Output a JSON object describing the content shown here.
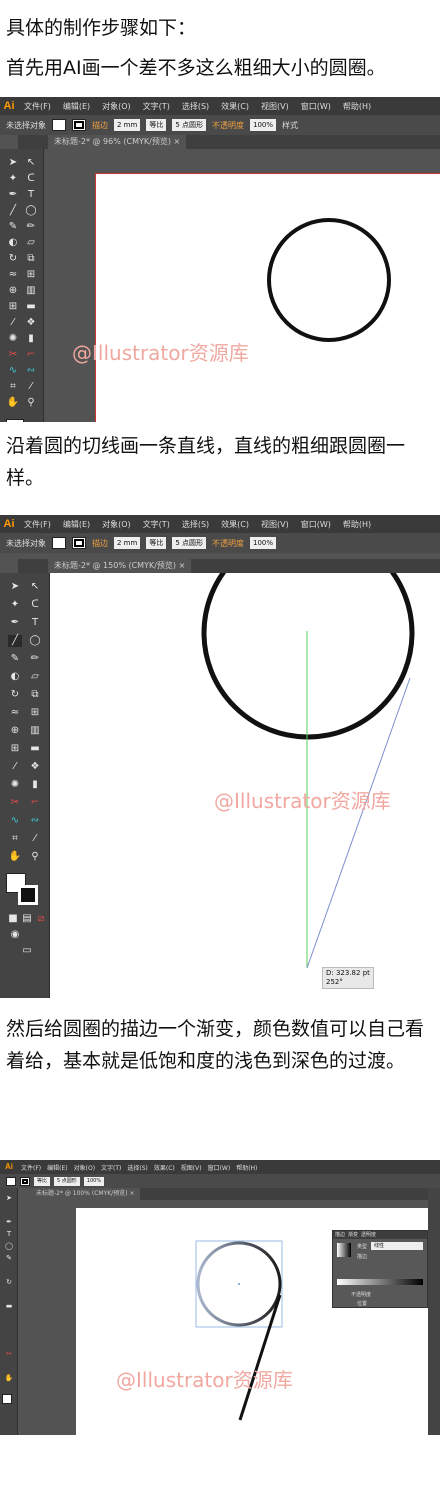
{
  "captions": {
    "intro": "具体的制作步骤如下：",
    "step1": "首先用AI画一个差不多这么粗细大小的圆圈。",
    "step2": "沿着圆的切线画一条直线，直线的粗细跟圆圈一样。",
    "step3": "然后给圆圈的描边一个渐变，颜色数值可以自己看着给，基本就是低饱和度的浅色到深色的过渡。"
  },
  "app": {
    "logo": "Ai",
    "menus": [
      "文件(F)",
      "编辑(E)",
      "对象(O)",
      "文字(T)",
      "选择(S)",
      "效果(C)",
      "视图(V)",
      "窗口(W)",
      "帮助(H)"
    ]
  },
  "control_bar": {
    "selection_status": "未选择对象",
    "stroke_label": "描边",
    "stroke_weight": "2 mm",
    "profile": "等比",
    "brush": "5 点圆形",
    "opacity_label": "不透明度",
    "opacity_value": "100%",
    "style_label": "样式"
  },
  "shots": [
    {
      "doc_tab": "未标题-2* @ 96% (CMYK/预览)",
      "close": "×"
    },
    {
      "doc_tab": "未标题-2* @ 150% (CMYK/预览)",
      "close": "×"
    },
    {
      "doc_tab": "未标题-2* @ 100% (CMYK/预览)",
      "close": "×"
    }
  ],
  "watermark": "@Illustrator资源库",
  "tooltip": {
    "distance": "D: 323.82 pt",
    "angle": "252°"
  },
  "gradient_panel": {
    "tabs": [
      "描边",
      "渐变",
      "透明度"
    ],
    "type_label": "类型",
    "type_value": "线性",
    "stroke_label": "描边",
    "opacity_label": "不透明度",
    "position_label": "位置"
  },
  "colors": {
    "accent": "#ff9a00",
    "app_bg": "#535353",
    "menubar": "#3a3a3a"
  }
}
